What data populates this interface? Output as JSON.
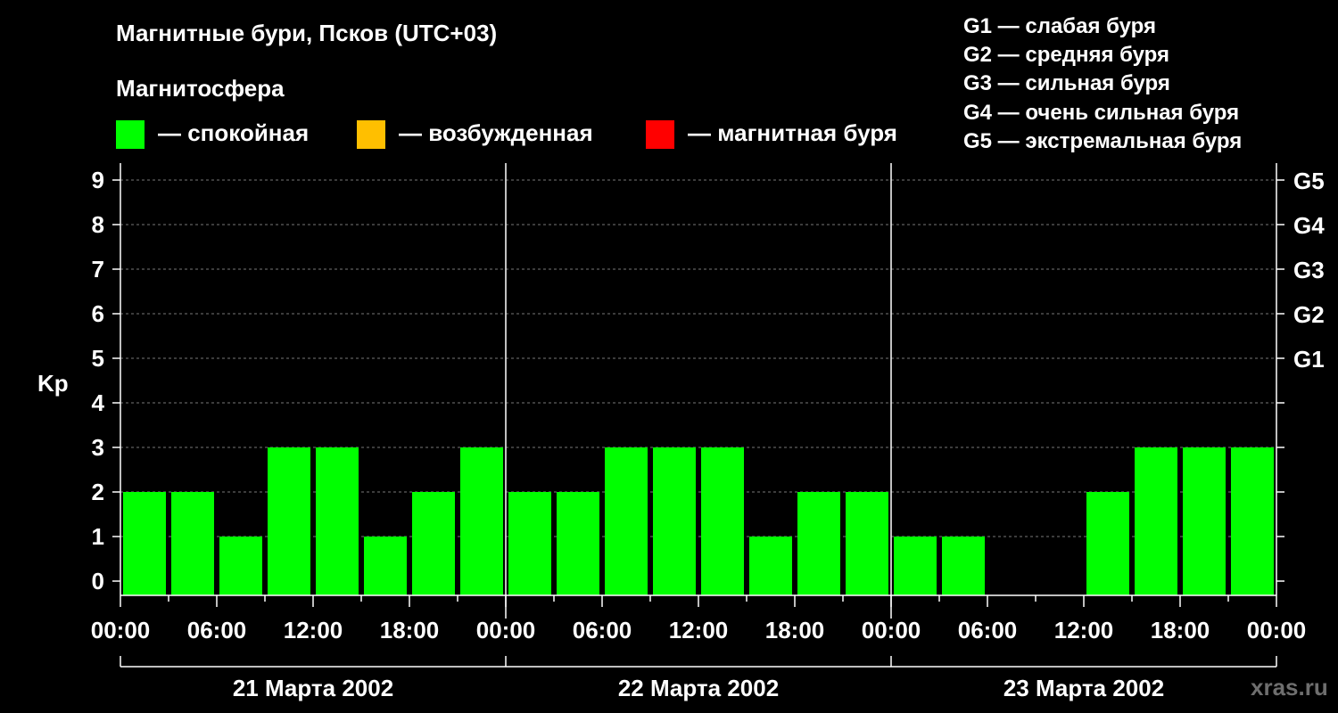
{
  "title": "Магнитные бури, Псков (UTC+03)",
  "magnetosphere": {
    "title": "Магнитосфера",
    "items": [
      {
        "label": "— спокойная",
        "color": "#00ff00"
      },
      {
        "label": "— возбужденная",
        "color": "#ffbf00"
      },
      {
        "label": "— магнитная буря",
        "color": "#ff0000"
      }
    ]
  },
  "storm_levels": [
    "G1 — слабая буря",
    "G2 — средняя буря",
    "G3 — сильная буря",
    "G4 — очень сильная буря",
    "G5 — экстремальная буря"
  ],
  "watermark": "xras.ru",
  "chart_data": {
    "type": "bar",
    "ylabel": "Kp",
    "ylim": [
      0,
      9
    ],
    "yticks": [
      "0",
      "1",
      "2",
      "3",
      "4",
      "5",
      "6",
      "7",
      "8",
      "9"
    ],
    "g_scale": [
      {
        "level": 5,
        "label": "G1"
      },
      {
        "level": 6,
        "label": "G2"
      },
      {
        "level": 7,
        "label": "G3"
      },
      {
        "level": 8,
        "label": "G4"
      },
      {
        "level": 9,
        "label": "G5"
      }
    ],
    "xtick_labels": [
      "00:00",
      "06:00",
      "12:00",
      "18:00",
      "00:00",
      "06:00",
      "12:00",
      "18:00",
      "00:00",
      "06:00",
      "12:00",
      "18:00",
      "00:00"
    ],
    "days": [
      "21 Марта 2002",
      "22 Марта 2002",
      "23 Марта 2002"
    ],
    "interval_hours": 3,
    "values": [
      2,
      2,
      1,
      3,
      3,
      1,
      2,
      3,
      2,
      2,
      3,
      3,
      3,
      1,
      2,
      2,
      1,
      1,
      0,
      0,
      2,
      3,
      3,
      3
    ],
    "bar_color": "#00ff00",
    "grid": true
  }
}
